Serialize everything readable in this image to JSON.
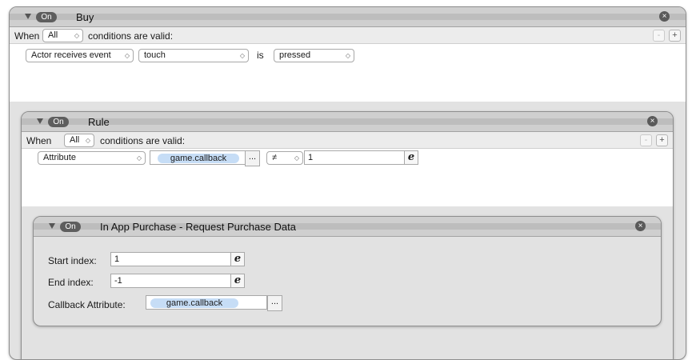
{
  "buy": {
    "on_label": "On",
    "title": "Buy",
    "when_label": "When",
    "all_option": "All",
    "conditions_label": "conditions are valid:",
    "condition": {
      "actor": "Actor receives event",
      "event": "touch",
      "is_label": "is",
      "state": "pressed"
    }
  },
  "rule": {
    "on_label": "On",
    "title": "Rule",
    "when_label": "When",
    "all_option": "All",
    "conditions_label": "conditions are valid:",
    "condition": {
      "type": "Attribute",
      "attribute": "game.callback",
      "ellipsis": "...",
      "operator": "≠",
      "value": "1"
    }
  },
  "iap": {
    "on_label": "On",
    "title": "In App Purchase - Request Purchase Data",
    "start_label": "Start index:",
    "start_value": "1",
    "end_label": "End index:",
    "end_value": "-1",
    "callback_label": "Callback Attribute:",
    "callback_value": "game.callback",
    "ellipsis": "..."
  },
  "icons": {
    "close": "×",
    "add": "+",
    "remove": "-",
    "expression": "e",
    "disclosure": "▼",
    "chevron": "⌃⌄"
  }
}
